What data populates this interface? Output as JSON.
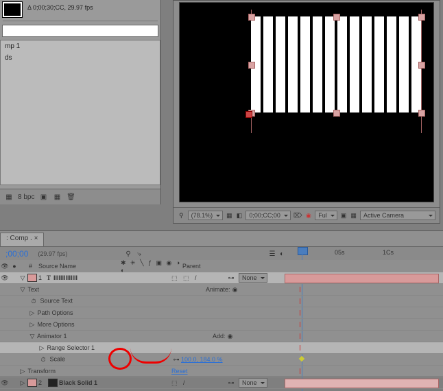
{
  "project": {
    "info": "Δ 0;00;30;CC, 29.97 fps",
    "items": [
      "mp 1",
      "ds"
    ],
    "footer_bpc": "8 bpc"
  },
  "viewer": {
    "zoom": "(78.1%)",
    "timecode": "0;00;CC;00",
    "quality": "Ful",
    "view": "Active Camera"
  },
  "timeline": {
    "tab": ": Comp .  ×",
    "timecode": ";00;00",
    "rate": "(29.97 fps)",
    "col_source": "Source Name",
    "col_parent": "Parent",
    "ruler": {
      "t1": "05s",
      "t2": "1Cs"
    },
    "parent_none": "None",
    "animate_label": "Animate:",
    "add_label": "Add:",
    "reset": "Reset",
    "scale_value": "100.0, 184.0 %",
    "layers": {
      "l1_num": "1",
      "l1_name": "IIIIIIIIIIIIII",
      "text": "Text",
      "source_text": "Source Text",
      "path_options": "Path Options",
      "more_options": "More Options",
      "animator1": "Animator 1",
      "range_selector": "Range Selector 1",
      "scale": "Scale",
      "transform": "Transform",
      "l2_num": "2",
      "l2_name": "Black Solid 1"
    }
  },
  "icons": {
    "search": "⌕",
    "folder": "▣",
    "trash": "🗑",
    "mag": "⚲",
    "grid": "▦",
    "mask": "◧",
    "cam": "⌦",
    "eye": "👁",
    "sun": "☀",
    "circle": "◉",
    "tri_r": "▷",
    "tri_d": "▽",
    "stopwatch": "⏱",
    "link": "⊶",
    "menu": "☰"
  }
}
